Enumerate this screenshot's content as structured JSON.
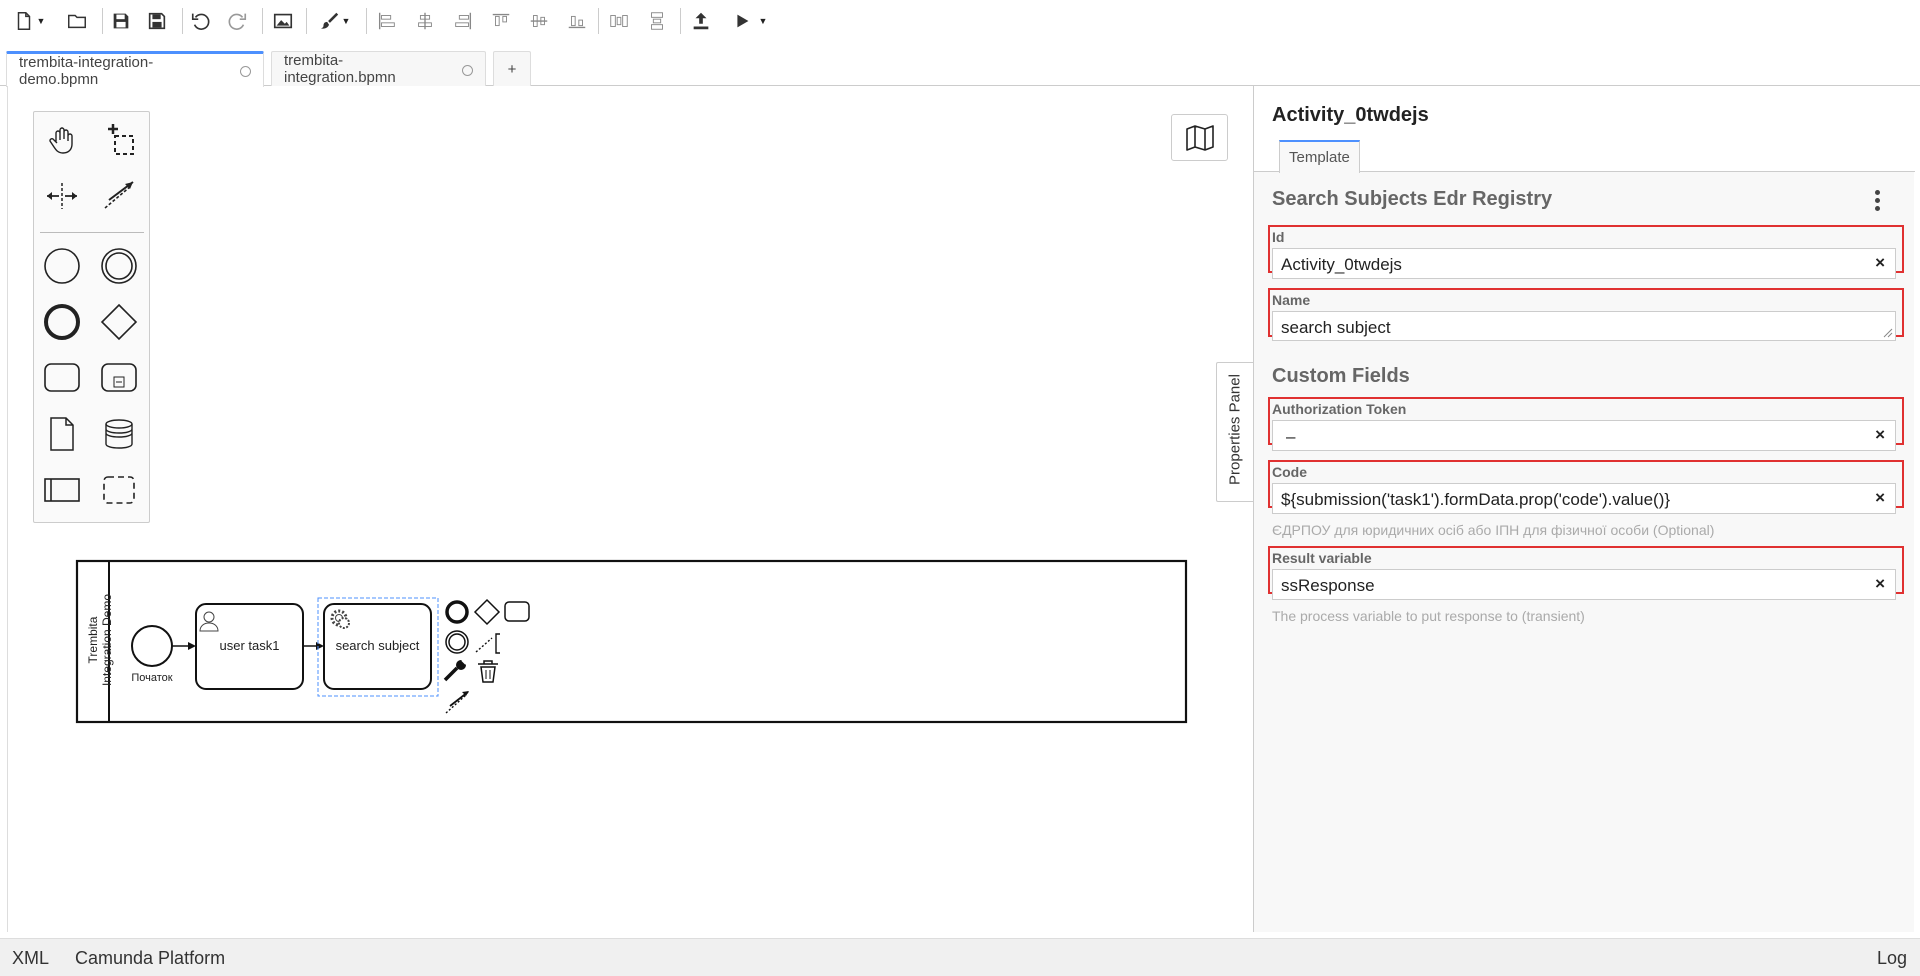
{
  "toolbar": {
    "buttons": [
      "new-file",
      "open-file",
      "save",
      "save-as",
      "undo",
      "redo",
      "export-image",
      "color-picker",
      "align-left",
      "align-center",
      "align-right",
      "align-top",
      "align-middle",
      "align-bottom",
      "distribute-horizontal",
      "distribute-vertical",
      "deploy",
      "start-instance"
    ]
  },
  "tabs": [
    {
      "label": "trembita-integration-demo.bpmn",
      "active": true
    },
    {
      "label": "trembita-integration.bpmn",
      "active": false
    }
  ],
  "new_tab_label": "+",
  "diagram": {
    "pool_label": "Trembita Integration Demo",
    "start_event_label": "Початок",
    "user_task_label": "user task1",
    "service_task_label": "search subject"
  },
  "properties_toggle_label": "Properties Panel",
  "panel": {
    "title": "Activity_0twdejs",
    "tab_label": "Template",
    "template_title": "Search Subjects Edr Registry",
    "id_label": "Id",
    "id_value": "Activity_0twdejs",
    "name_label": "Name",
    "name_value": "search subject",
    "custom_fields_title": "Custom Fields",
    "auth_label": "Authorization Token",
    "auth_value": "–",
    "code_label": "Code",
    "code_value": "${submission('task1').formData.prop('code').value()}",
    "code_desc": "ЄДРПОУ для юридичних осіб або ІПН для фізичної особи (Optional)",
    "result_label": "Result variable",
    "result_value": "ssResponse",
    "result_desc": "The process variable to put response to (transient)",
    "highlight_color": "#e03131"
  },
  "statusbar": {
    "xml_label": "XML",
    "platform_label": "Camunda Platform",
    "log_label": "Log"
  },
  "colors": {
    "accent": "#4d90fe",
    "highlight": "#e03131",
    "selection": "#4d90fe"
  }
}
